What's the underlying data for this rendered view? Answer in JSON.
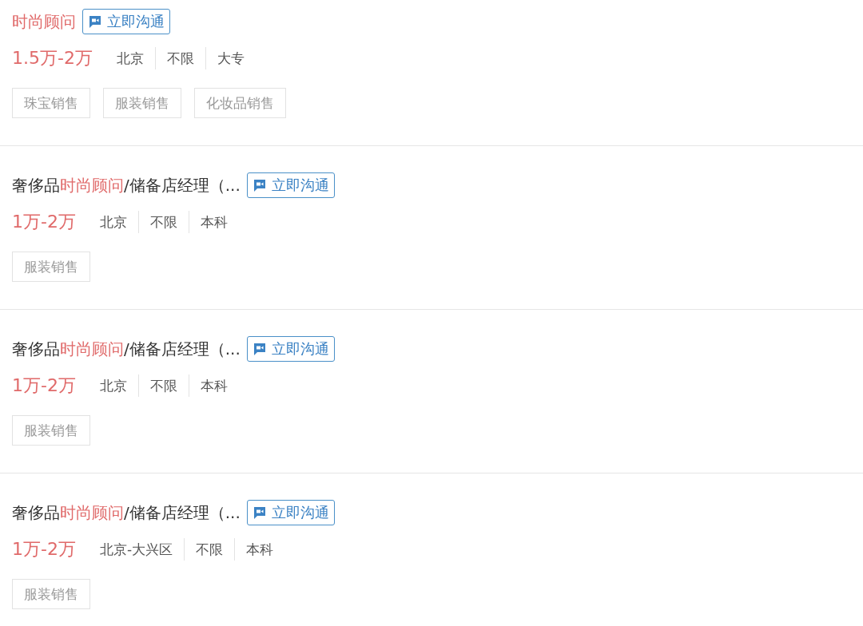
{
  "jobs": [
    {
      "title": [
        {
          "text": "时尚顾问",
          "highlight": true
        }
      ],
      "chat_button": "立即沟通",
      "salary": "1.5万-2万",
      "info": [
        "北京",
        "不限",
        "大专"
      ],
      "tags": [
        "珠宝销售",
        "服装销售",
        "化妆品销售"
      ]
    },
    {
      "title": [
        {
          "text": "奢侈品",
          "highlight": false
        },
        {
          "text": "时尚顾问",
          "highlight": true
        },
        {
          "text": "/储备店经理（...",
          "highlight": false
        }
      ],
      "chat_button": "立即沟通",
      "salary": "1万-2万",
      "info": [
        "北京",
        "不限",
        "本科"
      ],
      "tags": [
        "服装销售"
      ]
    },
    {
      "title": [
        {
          "text": "奢侈品",
          "highlight": false
        },
        {
          "text": "时尚顾问",
          "highlight": true
        },
        {
          "text": "/储备店经理（...",
          "highlight": false
        }
      ],
      "chat_button": "立即沟通",
      "salary": "1万-2万",
      "info": [
        "北京",
        "不限",
        "本科"
      ],
      "tags": [
        "服装销售"
      ]
    },
    {
      "title": [
        {
          "text": "奢侈品",
          "highlight": false
        },
        {
          "text": "时尚顾问",
          "highlight": true
        },
        {
          "text": "/储备店经理（...",
          "highlight": false
        }
      ],
      "chat_button": "立即沟通",
      "salary": "1万-2万",
      "info": [
        "北京-大兴区",
        "不限",
        "本科"
      ],
      "tags": [
        "服装销售"
      ]
    }
  ]
}
